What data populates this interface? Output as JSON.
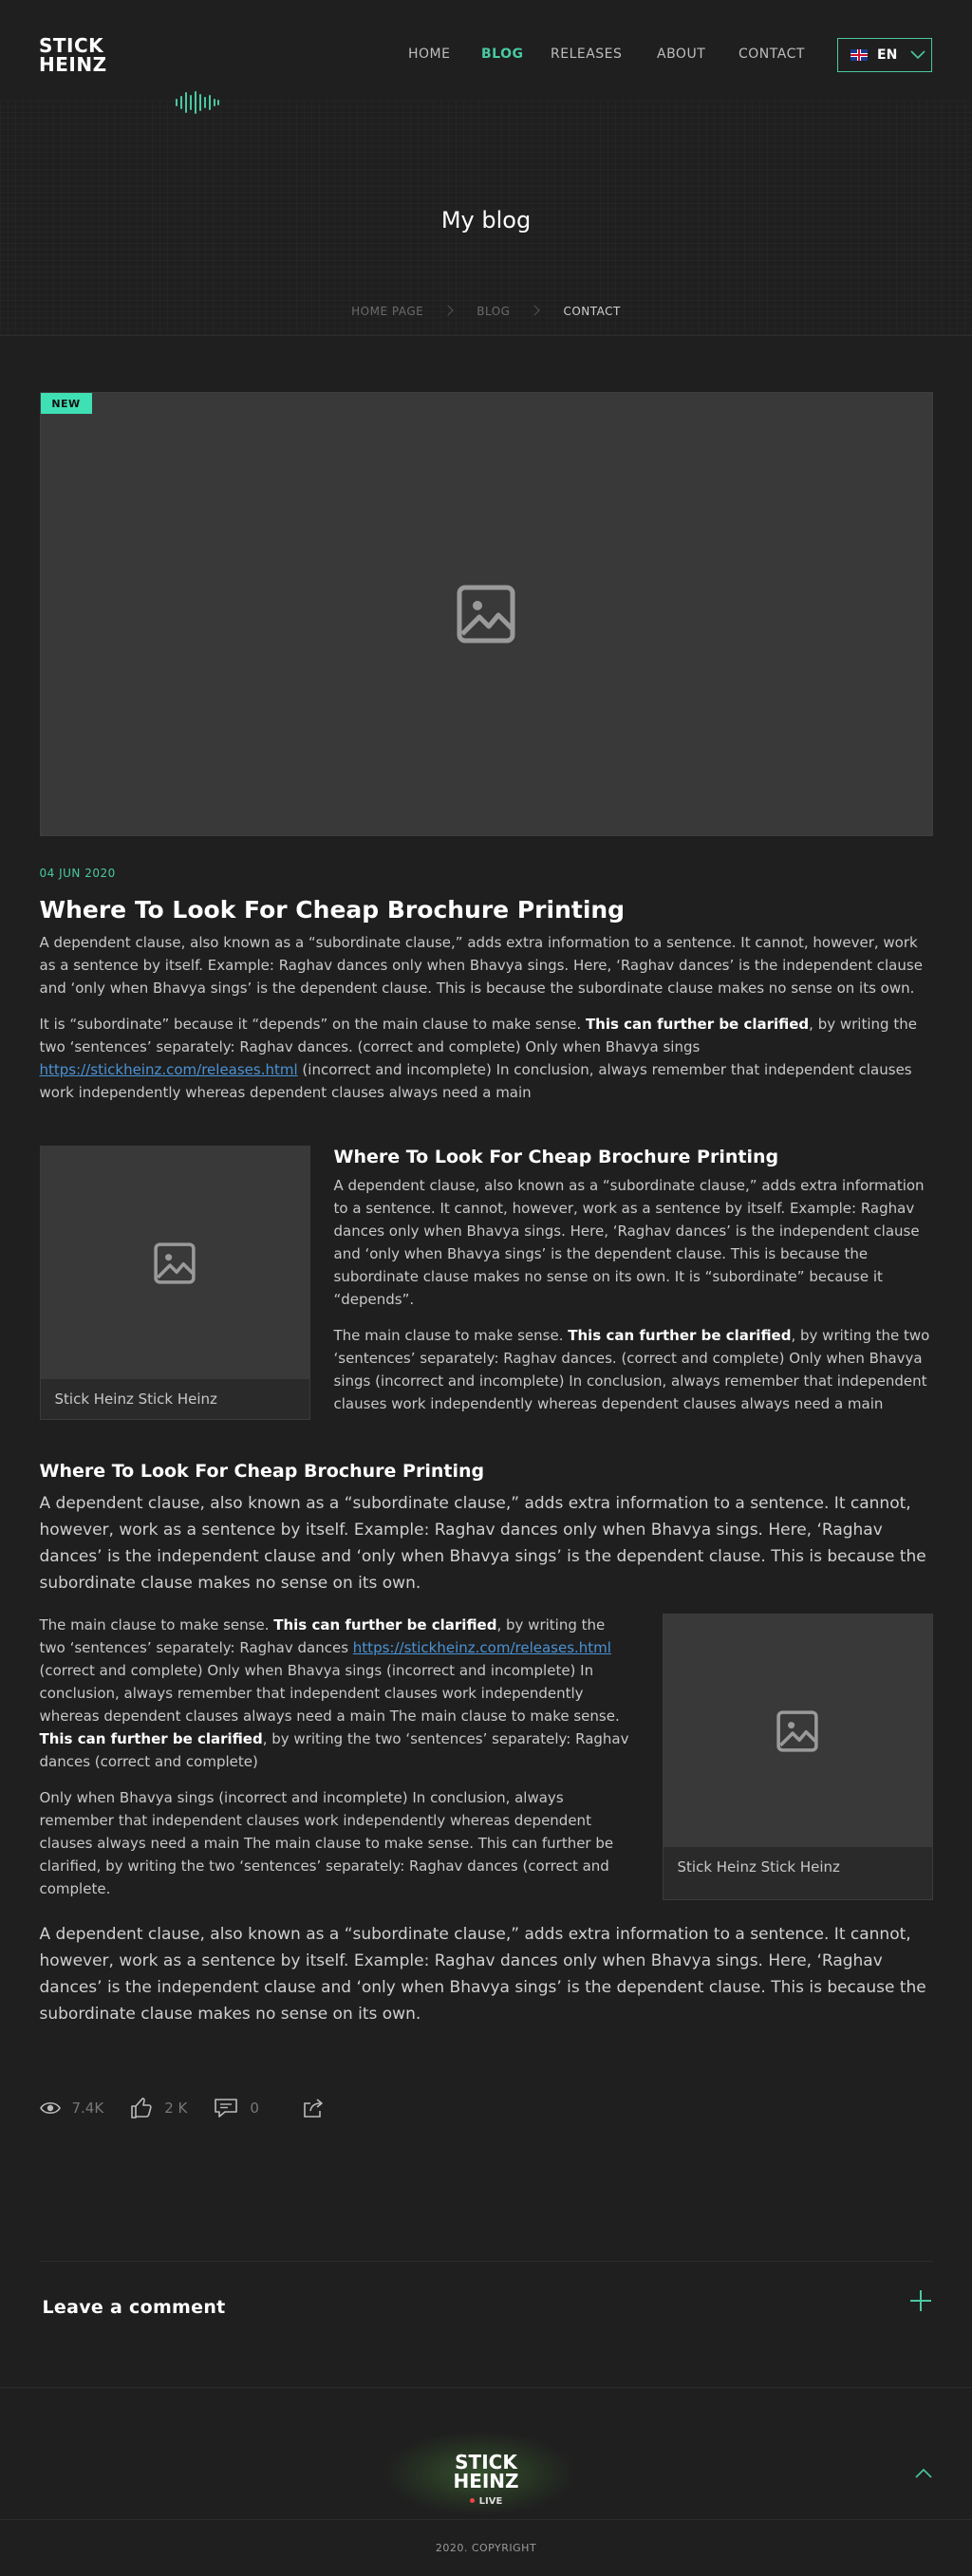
{
  "header": {
    "logo_line1": "STICK",
    "logo_line2": "HEINZ",
    "nav": [
      {
        "label": "HOME",
        "active": false
      },
      {
        "label": "BLOG",
        "active": true
      },
      {
        "label": "RELEASES",
        "active": false
      },
      {
        "label": "ABOUT",
        "active": false
      },
      {
        "label": "CONTACT",
        "active": false
      }
    ],
    "language": "EN",
    "accent": "#49c9a1"
  },
  "hero": {
    "title": "My blog",
    "breadcrumb": [
      "HOME PAGE",
      "BLOG",
      "CONTACT"
    ]
  },
  "article": {
    "badge": "NEW",
    "date": "04 JUN 2020",
    "title": "Where To Look For Cheap Brochure Printing",
    "p1": "A dependent clause, also known as a “subordinate clause,” adds extra information to a sentence. It cannot, however, work as a sentence by itself. Example: Raghav dances only when Bhavya sings. Here, ‘Raghav dances’ is the independent clause and ‘only when Bhavya sings’ is the dependent clause. This is because the subordinate clause makes no sense on its own.",
    "p2_a": "It is “subordinate” because it “depends” on the main clause to make sense. ",
    "p2_bold": "This can further be clarified",
    "p2_b": ", by writing the two ‘sentences’ separately:  Raghav dances. (correct and complete) Only when Bhavya sings ",
    "p2_link": "https://stickheinz.com/releases.html",
    "p2_c": " (incorrect and incomplete) In conclusion, always remember that independent clauses work independently whereas dependent clauses always need a main",
    "section1": {
      "caption": "Stick Heinz Stick Heinz",
      "title": "Where To Look For Cheap Brochure Printing",
      "p1": "A dependent clause, also known as a “subordinate clause,” adds extra information to a sentence. It cannot, however, work as a sentence by itself. Example: Raghav dances only when Bhavya sings. Here, ‘Raghav dances’ is the independent clause and ‘only when Bhavya sings’ is the dependent clause. This is because the subordinate clause makes no sense on its own. It is “subordinate” because it “depends”.",
      "p2_a": "The main clause to make sense. ",
      "p2_bold": "This can further be clarified",
      "p2_b": ", by writing the two ‘sentences’ separately:  Raghav dances. (correct and complete) Only when Bhavya sings (incorrect and incomplete) In conclusion, always remember that independent clauses work independently whereas dependent clauses always need a main"
    },
    "section2": {
      "title": "Where To Look For Cheap Brochure Printing",
      "lead": "A dependent clause, also known as a “subordinate clause,” adds extra information to a sentence. It cannot, however, work as a sentence by itself. Example: Raghav dances only when Bhavya sings. Here, ‘Raghav dances’ is the independent clause and ‘only when Bhavya sings’ is the dependent clause. This is because the subordinate clause makes no sense on its own.",
      "p1_a": "The main clause to make sense. ",
      "p1_bold1": "This can further be clarified",
      "p1_b": ", by writing the two ‘sentences’ separately:  Raghav dances ",
      "p1_link": "https://stickheinz.com/releases.html",
      "p1_c": " (correct and complete)  Only when Bhavya sings (incorrect and incomplete) In conclusion, always remember that independent clauses work independently whereas dependent clauses always need a main The main clause to make sense. ",
      "p1_bold2": "This can further be clarified",
      "p1_d": ", by writing the two ‘sentences’ separately:  Raghav dances  (correct and complete)",
      "p2": "Only when Bhavya sings (incorrect and incomplete) In conclusion, always remember that independent clauses work independently whereas dependent clauses always need a main The main clause to make sense. This can further be clarified, by writing the two ‘sentences’ separately:  Raghav dances (correct and  complete.",
      "caption": "Stick Heinz Stick Heinz",
      "closing": "A dependent clause, also known as a “subordinate clause,” adds extra information to a sentence. It cannot, however, work as a sentence by itself. Example: Raghav dances only when Bhavya sings. Here, ‘Raghav dances’ is the independent clause and ‘only when Bhavya sings’ is the dependent clause. This is because the subordinate clause makes no sense on its own."
    },
    "stats": {
      "views": "7.4K",
      "likes": "2 K",
      "comments": "0"
    }
  },
  "comments": {
    "label": "Leave a comment"
  },
  "footer": {
    "logo_line1": "STICK",
    "logo_line2": "HEINZ",
    "live": "LIVE",
    "copyright": "2020. COPYRIGHT"
  }
}
